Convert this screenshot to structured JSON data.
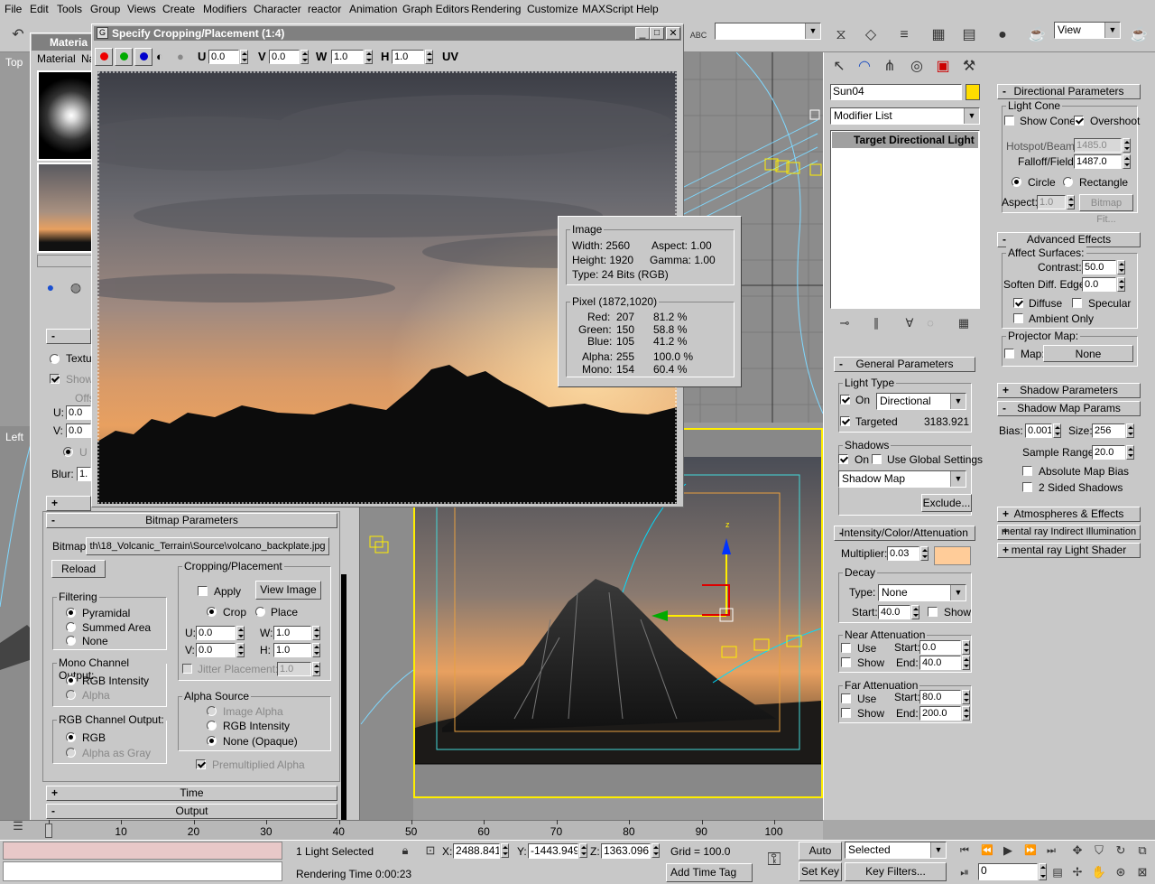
{
  "menu": [
    "File",
    "Edit",
    "Tools",
    "Group",
    "Views",
    "Create",
    "Modifiers",
    "Character",
    "reactor",
    "Animation",
    "Graph Editors",
    "Rendering",
    "Customize",
    "MAXScript",
    "Help"
  ],
  "toolbar": {
    "view_dropdown": "View"
  },
  "crop_window": {
    "title": "Specify Cropping/Placement (1:4)",
    "u_label": "U",
    "u": "0.0",
    "v_label": "V",
    "v": "0.0",
    "w_label": "W",
    "w": "1.0",
    "h_label": "H",
    "h": "1.0",
    "uv_label": "UV"
  },
  "info": {
    "image_title": "Image",
    "width": "Width:  2560",
    "height": "Height: 1920",
    "type": "Type:  24 Bits (RGB)",
    "aspect": "Aspect: 1.00",
    "gamma": "Gamma: 1.00",
    "pixel_title": "Pixel (1872,1020)",
    "rows": [
      {
        "name": "Red:",
        "val": "207",
        "pct": "81.2 %"
      },
      {
        "name": "Green:",
        "val": "150",
        "pct": "58.8 %"
      },
      {
        "name": "Blue:",
        "val": "105",
        "pct": "41.2 %"
      },
      {
        "name": "Alpha:",
        "val": "255",
        "pct": "100.0 %"
      },
      {
        "name": "Mono:",
        "val": "154",
        "pct": "60.4 %"
      }
    ]
  },
  "material": {
    "title": "Materia",
    "menu_material": "Material",
    "menu_nav": "Na",
    "textu": "Textu",
    "show": "Show",
    "offs": "Offs",
    "u": "U:",
    "u_val": "0.0",
    "v": "V:",
    "v_val": "0.0",
    "uv": "U",
    "blur": "Blur:",
    "blur_val": "1."
  },
  "bitmap_params": {
    "header": "Bitmap Parameters",
    "bitmap_label": "Bitmap:",
    "bitmap_path": "th\\18_Volcanic_Terrain\\Source\\volcano_backplate.jpg",
    "reload": "Reload",
    "filtering": "Filtering",
    "pyramidal": "Pyramidal",
    "summed": "Summed Area",
    "none": "None",
    "mono_title": "Mono Channel Output:",
    "rgb_intensity": "RGB Intensity",
    "alpha": "Alpha",
    "rgb_title": "RGB Channel Output:",
    "rgb": "RGB",
    "alpha_gray": "Alpha as Gray",
    "crop_title": "Cropping/Placement",
    "apply": "Apply",
    "view_image": "View Image",
    "crop": "Crop",
    "place": "Place",
    "cu": "U:",
    "cu_val": "0.0",
    "cw": "W:",
    "cw_val": "1.0",
    "cv": "V:",
    "cv_val": "0.0",
    "ch": "H:",
    "ch_val": "1.0",
    "jitter": "Jitter Placement:",
    "jitter_val": "1.0",
    "alpha_source": "Alpha Source",
    "image_alpha": "Image Alpha",
    "rgb_int2": "RGB Intensity",
    "none_opaque": "None (Opaque)",
    "premult": "Premultiplied Alpha",
    "time": "Time",
    "output": "Output"
  },
  "viewports": {
    "top": "Top",
    "left": "Left"
  },
  "cmd": {
    "object_name": "Sun04",
    "modifier_list": "Modifier List",
    "stack_item": "Target Directional Light",
    "object_color": "#ffdd00",
    "general": "General Parameters",
    "light_type": "Light Type",
    "on": "On",
    "light_drop": "Directional",
    "targeted": "Targeted",
    "targeted_val": "3183.921",
    "shadows": "Shadows",
    "shadow_on": "On",
    "use_global": "Use Global Settings",
    "shadow_drop": "Shadow Map",
    "exclude": "Exclude...",
    "intensity": "Intensity/Color/Attenuation",
    "multiplier": "Multiplier:",
    "mult_val": "0.03",
    "light_color": "#ffcc99",
    "decay": "Decay",
    "type": "Type:",
    "type_val": "None",
    "start": "Start:",
    "start_val": "40.0",
    "show": "Show",
    "near": "Near Attenuation",
    "use": "Use",
    "nstart_val": "0.0",
    "end": "End:",
    "nend_val": "40.0",
    "far": "Far Attenuation",
    "fstart_val": "80.0",
    "fend_val": "200.0"
  },
  "right": {
    "directional": "Directional Parameters",
    "light_cone": "Light Cone",
    "show_cone": "Show Cone",
    "overshoot": "Overshoot",
    "hotspot": "Hotspot/Beam:",
    "hotspot_val": "1485.0",
    "falloff": "Falloff/Field:",
    "falloff_val": "1487.0",
    "circle": "Circle",
    "rectangle": "Rectangle",
    "aspect": "Aspect:",
    "aspect_val": "1.0",
    "bitmap_fit": "Bitmap Fit...",
    "advanced": "Advanced Effects",
    "affect": "Affect Surfaces:",
    "contrast": "Contrast:",
    "contrast_val": "50.0",
    "soften": "Soften Diff. Edge:",
    "soften_val": "0.0",
    "diffuse": "Diffuse",
    "specular": "Specular",
    "ambient": "Ambient Only",
    "projector": "Projector Map:",
    "map": "Map:",
    "map_val": "None",
    "shadow_params": "Shadow Parameters",
    "shadow_map_params": "Shadow Map Params",
    "bias": "Bias:",
    "bias_val": "0.001",
    "size": "Size:",
    "size_val": "256",
    "sample": "Sample Range:",
    "sample_val": "20.0",
    "abs_bias": "Absolute Map Bias",
    "two_sided": "2 Sided Shadows",
    "atmos": "Atmospheres & Effects",
    "mental_gi": "mental ray Indirect Illumination",
    "mental_shader": "mental ray Light Shader"
  },
  "timeline": {
    "ticks": [
      "0",
      "10",
      "20",
      "30",
      "40",
      "50",
      "60",
      "70",
      "80",
      "90",
      "100"
    ]
  },
  "status": {
    "selected": "1 Light Selected",
    "x_label": "X:",
    "x": "2488.841",
    "y_label": "Y:",
    "y": "-1443.949",
    "z_label": "Z:",
    "z": "1363.096",
    "grid": "Grid = 100.0",
    "auto_key": "Auto Key",
    "selected_drop": "Selected",
    "set_key": "Set Key",
    "key_filters": "Key Filters...",
    "frame": "0",
    "render_time": "Rendering Time  0:00:23",
    "add_time_tag": "Add Time Tag"
  }
}
